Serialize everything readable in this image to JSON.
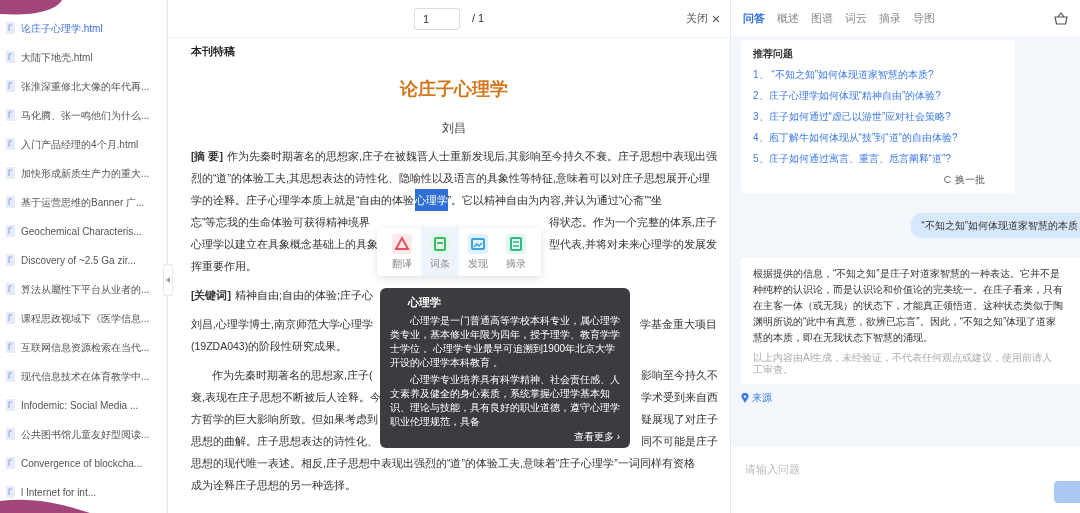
{
  "sidebar": {
    "items": [
      {
        "label": "论庄子心理学.html",
        "selected": true
      },
      {
        "label": "大陆下地壳.html",
        "selected": false
      },
      {
        "label": "张淮深重修北大像的年代再...",
        "selected": false
      },
      {
        "label": "马化腾、张一鸣他们为什么...",
        "selected": false
      },
      {
        "label": "入门产品经理的4个月.html",
        "selected": false
      },
      {
        "label": "加快形成新质生产力的重大...",
        "selected": false
      },
      {
        "label": "基于运营思维的Banner 广...",
        "selected": false
      },
      {
        "label": "Geochemical Characteris...",
        "selected": false
      },
      {
        "label": "Discovery of ~2.5 Ga zir...",
        "selected": false
      },
      {
        "label": "算法从屬性下平台从业者的...",
        "selected": false
      },
      {
        "label": "课程思政视域下《医学信息...",
        "selected": false
      },
      {
        "label": "互联网信息资源检索在当代...",
        "selected": false
      },
      {
        "label": "现代信息技术在体育教学中...",
        "selected": false
      },
      {
        "label": "Infodemic: Social Media ...",
        "selected": false
      },
      {
        "label": "公共图书馆儿童友好型阅读...",
        "selected": false
      },
      {
        "label": "Convergence of blockcha...",
        "selected": false
      },
      {
        "label": "l Internet for int...",
        "selected": false
      }
    ]
  },
  "viewer": {
    "page_input": "1",
    "page_total": "/ 1",
    "close": "关闭",
    "section": "本刊特稿",
    "title": "论庄子心理学",
    "author": "刘昌",
    "paragraphs": [
      {
        "label": "[摘 要]",
        "indent": false,
        "lines": [
          {
            "kind": "full",
            "text": "作为先秦时期著名的思想家,庄子在被魏晋人士重新发现后,其影响至今持久不衰。庄子思想中表现出强"
          },
          {
            "kind": "full",
            "text": "烈的“道”的体验工夫,其思想表达的诗性化、隐喻性以及语言的具象性等特征,意味着可以对庄子思想展开心理"
          },
          {
            "kind": "highlight",
            "before": "学的诠释。庄子心理学本质上就是“自由的体验",
            "highlight": "心理学",
            "after": "”。它以精神自由为内容,并认为通过“心斋”“坐"
          },
          {
            "kind": "split",
            "left": "忘”等忘我的生命体验可获得精神境界",
            "right": "得状态。作为一个完整的体系,庄子"
          },
          {
            "kind": "split",
            "left": "心理学以建立在具象概念基础上的具象",
            "right": "型代表,并将对未来心理学的发展发"
          },
          {
            "kind": "full",
            "text": "挥重要作用。"
          }
        ]
      },
      {
        "label": "[关键词]",
        "indent": false,
        "lines": [
          {
            "kind": "split",
            "left": "精神自由;自由的体验;庄子心"
          }
        ]
      },
      {
        "indent": false,
        "lines": [
          {
            "kind": "split",
            "left": "刘昌,心理学博士,南京师范大学心理学",
            "right": "学基金重大项目"
          },
          {
            "kind": "full",
            "text": "(19ZDA043)的阶段性研究成果。"
          }
        ]
      },
      {
        "indent": true,
        "lines": [
          {
            "kind": "split",
            "left": "作为先秦时期著名的思想家,庄子(",
            "right": "影响至今持久不"
          },
          {
            "kind": "split",
            "left": "衰,表现在庄子思想不断被后人诠释。今",
            "right": "学术受到来自西"
          },
          {
            "kind": "split",
            "left": "方哲学的巨大影响所致。但如果考虑到",
            "right": "疑展现了对庄子"
          },
          {
            "kind": "split",
            "left": "思想的曲解。庄子思想表达的诗性化、",
            "right": "同不可能是庄子"
          },
          {
            "kind": "full",
            "text": "思想的现代唯一表述。相反,庄子思想中表现出强烈的“道”的体验工夫,意味着“庄子心理学”一词同样有资格"
          },
          {
            "kind": "full",
            "text": "成为诠释庄子思想的另一种选择。"
          }
        ]
      }
    ],
    "toolbar": [
      {
        "kind": "translate",
        "label": "翻译",
        "selected": false
      },
      {
        "kind": "entry",
        "label": "词条",
        "selected": true
      },
      {
        "kind": "discover",
        "label": "发现",
        "selected": false
      },
      {
        "kind": "excerpt",
        "label": "摘录",
        "selected": false
      }
    ],
    "popup": {
      "title": "心理学",
      "paragraphs": [
        "心理学是一门普通高等学校本科专业，属心理学类专业，基本修业年限为四年，授予理学、教育学学士学位 。心理学专业最早可追溯到1900年北京大学开设的心理学本科教育 。",
        "心理学专业培养具有科学精神、社会责任感、人文素养及健全的身心素质，系统掌握心理学基本知识、理论与技能，具有良好的职业道德，遵守心理学职业伦理规范，具备"
      ],
      "more": "查看更多 ›"
    }
  },
  "assistant": {
    "tabs": [
      {
        "label": "问答",
        "selected": true
      },
      {
        "label": "概述",
        "selected": false
      },
      {
        "label": "图谱",
        "selected": false
      },
      {
        "label": "词云",
        "selected": false
      },
      {
        "label": "摘录",
        "selected": false
      },
      {
        "label": "导图",
        "selected": false
      }
    ],
    "recommend_title": "推荐问题",
    "questions": [
      "1、 “不知之知”如何体现道家智慧的本质?",
      "2、庄子心理学如何体现“精神自由”的体验?",
      "3、庄子如何通过“虚己以游世”应对社会策略?",
      "4、庖丁解牛如何体现从“技”到“道”的自由体验?",
      "5、庄子如何通过寓言、重言、卮言阐释“道”?"
    ],
    "refresh": "换一批",
    "user_message": "“不知之知”如何体现道家智慧的本质",
    "answer_lines": [
      "根据提供的信息，“不知之知”是庄子对道家智慧的一种表达。它并不是",
      "种纯粹的认识论，而是认识论和价值论的完美统一。在庄子看来，只有",
      "在主客一体（或无我）的状态下，才能真正领悟道。这种状态类似于陶",
      "渊明所说的“此中有真意，欲辨已忘言”。因此，“不知之知”体现了道家",
      "慧的本质，即在无我状态下智慧的涌现。"
    ],
    "disclaimer": "以上内容由AI生成，未经验证，不代表任何观点或建议，使用前请人工审查。",
    "source": "来源",
    "input_placeholder": "请输入问题"
  }
}
